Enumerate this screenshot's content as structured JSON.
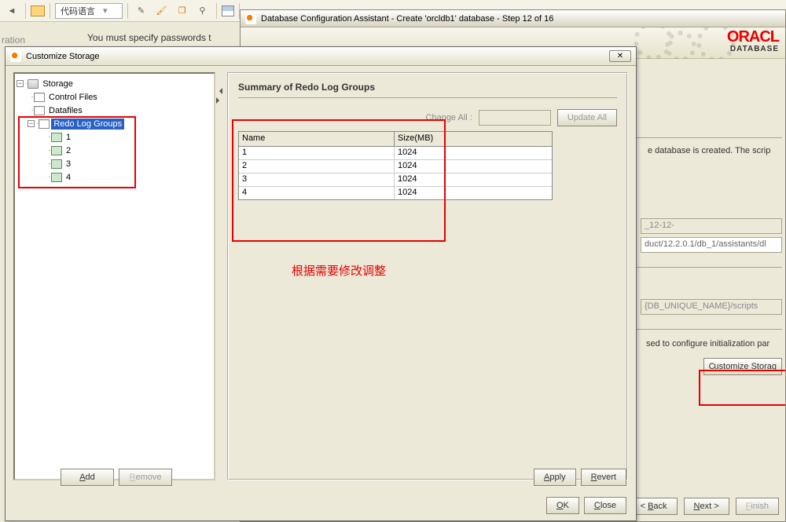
{
  "toolbar": {
    "code_lang": "代码语言"
  },
  "bg_text_left": "ration",
  "pass_text": "You must specify passwords t",
  "dbca": {
    "title": "Database Configuration Assistant - Create 'orcldb1' database - Step 12 of 16",
    "logo": "ORACL",
    "logo_sub": "DATABASE",
    "line1": "e database is created. The scrip",
    "field1": "_12-12-",
    "field2": "duct/12.2.0.1/db_1/assistants/dl",
    "field3": "{DB_UNIQUE_NAME}/scripts",
    "line2": "sed to configure initialization par",
    "customize": "Customize Storag",
    "back": "< Back",
    "next": "Next >",
    "finish": "Finish"
  },
  "modal": {
    "title": "Customize Storage",
    "tree": {
      "root": "Storage",
      "control": "Control Files",
      "datafiles": "Datafiles",
      "redo": "Redo Log Groups",
      "g1": "1",
      "g2": "2",
      "g3": "3",
      "g4": "4"
    },
    "section_title": "Summary of Redo Log Groups",
    "change_all": "Change All :",
    "update_all": "Update All",
    "col_name": "Name",
    "col_size": "Size(MB)",
    "rows": [
      {
        "name": "1",
        "size": "1024"
      },
      {
        "name": "2",
        "size": "1024"
      },
      {
        "name": "3",
        "size": "1024"
      },
      {
        "name": "4",
        "size": "1024"
      }
    ],
    "note": "根据需要修改调整",
    "add": "Add",
    "remove": "Remove",
    "apply": "Apply",
    "revert": "Revert",
    "ok": "OK",
    "close": "Close"
  }
}
